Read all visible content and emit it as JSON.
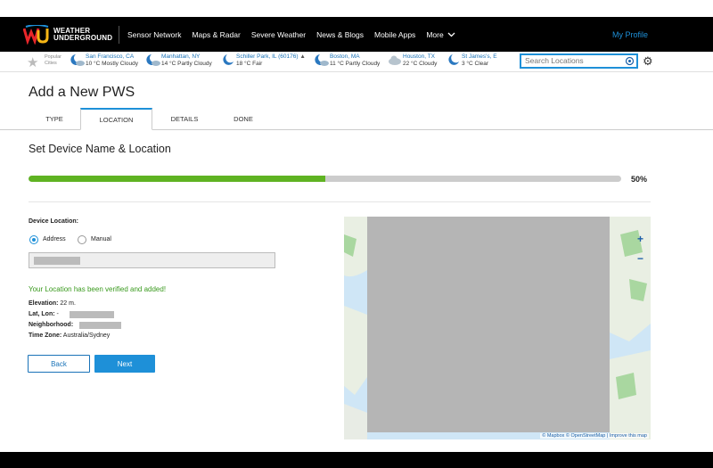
{
  "nav": {
    "logo_line1": "WEATHER",
    "logo_line2": "UNDERGROUND",
    "links": [
      "Sensor Network",
      "Maps & Radar",
      "Severe Weather",
      "News & Blogs",
      "Mobile Apps",
      "More"
    ],
    "profile": "My Profile"
  },
  "citybar": {
    "popular_line1": "Popular",
    "popular_line2": "Cities",
    "cities": [
      {
        "name": "San Francisco, CA",
        "cond": "10 °C Mostly Cloudy",
        "icon": "moon-cloud-icon"
      },
      {
        "name": "Manhattan, NY",
        "cond": "14 °C Partly Cloudy",
        "icon": "moon-cloud-icon"
      },
      {
        "name": "Schiller Park, IL (60176)",
        "cond": "18 °C Fair",
        "icon": "moon-icon"
      },
      {
        "name": "Boston, MA",
        "cond": "11 °C Partly Cloudy",
        "icon": "moon-cloud-icon"
      },
      {
        "name": "Houston, TX",
        "cond": "22 °C Cloudy",
        "icon": "cloud-icon"
      },
      {
        "name": "St James's, E",
        "cond": "3 °C Clear",
        "icon": "moon-icon"
      }
    ],
    "search_placeholder": "Search Locations"
  },
  "page": {
    "title": "Add a New PWS",
    "tabs": [
      "TYPE",
      "LOCATION",
      "DETAILS",
      "DONE"
    ],
    "active_tab": "LOCATION",
    "section_title": "Set Device Name & Location",
    "progress": 0.5,
    "progress_label": "50%"
  },
  "form": {
    "device_location_label": "Device Location:",
    "radio_address": "Address",
    "radio_manual": "Manual",
    "selected": "Address",
    "verified_msg": "Your Location has been verified and added!",
    "elevation_label": "Elevation:",
    "elevation_value": "22 m.",
    "latlon_label": "Lat, Lon:",
    "latlon_value": "-",
    "neighborhood_label": "Neighborhood:",
    "timezone_label": "Time Zone:",
    "timezone_value": "Australia/Sydney",
    "back_label": "Back",
    "next_label": "Next"
  },
  "map": {
    "credit": "© Mapbox © OpenStreetMap | Improve this map",
    "zoom_in": "+",
    "zoom_out": "−"
  },
  "colors": {
    "accent": "#1e90d8",
    "progress": "#5fb322",
    "success": "#3a9a1e"
  }
}
